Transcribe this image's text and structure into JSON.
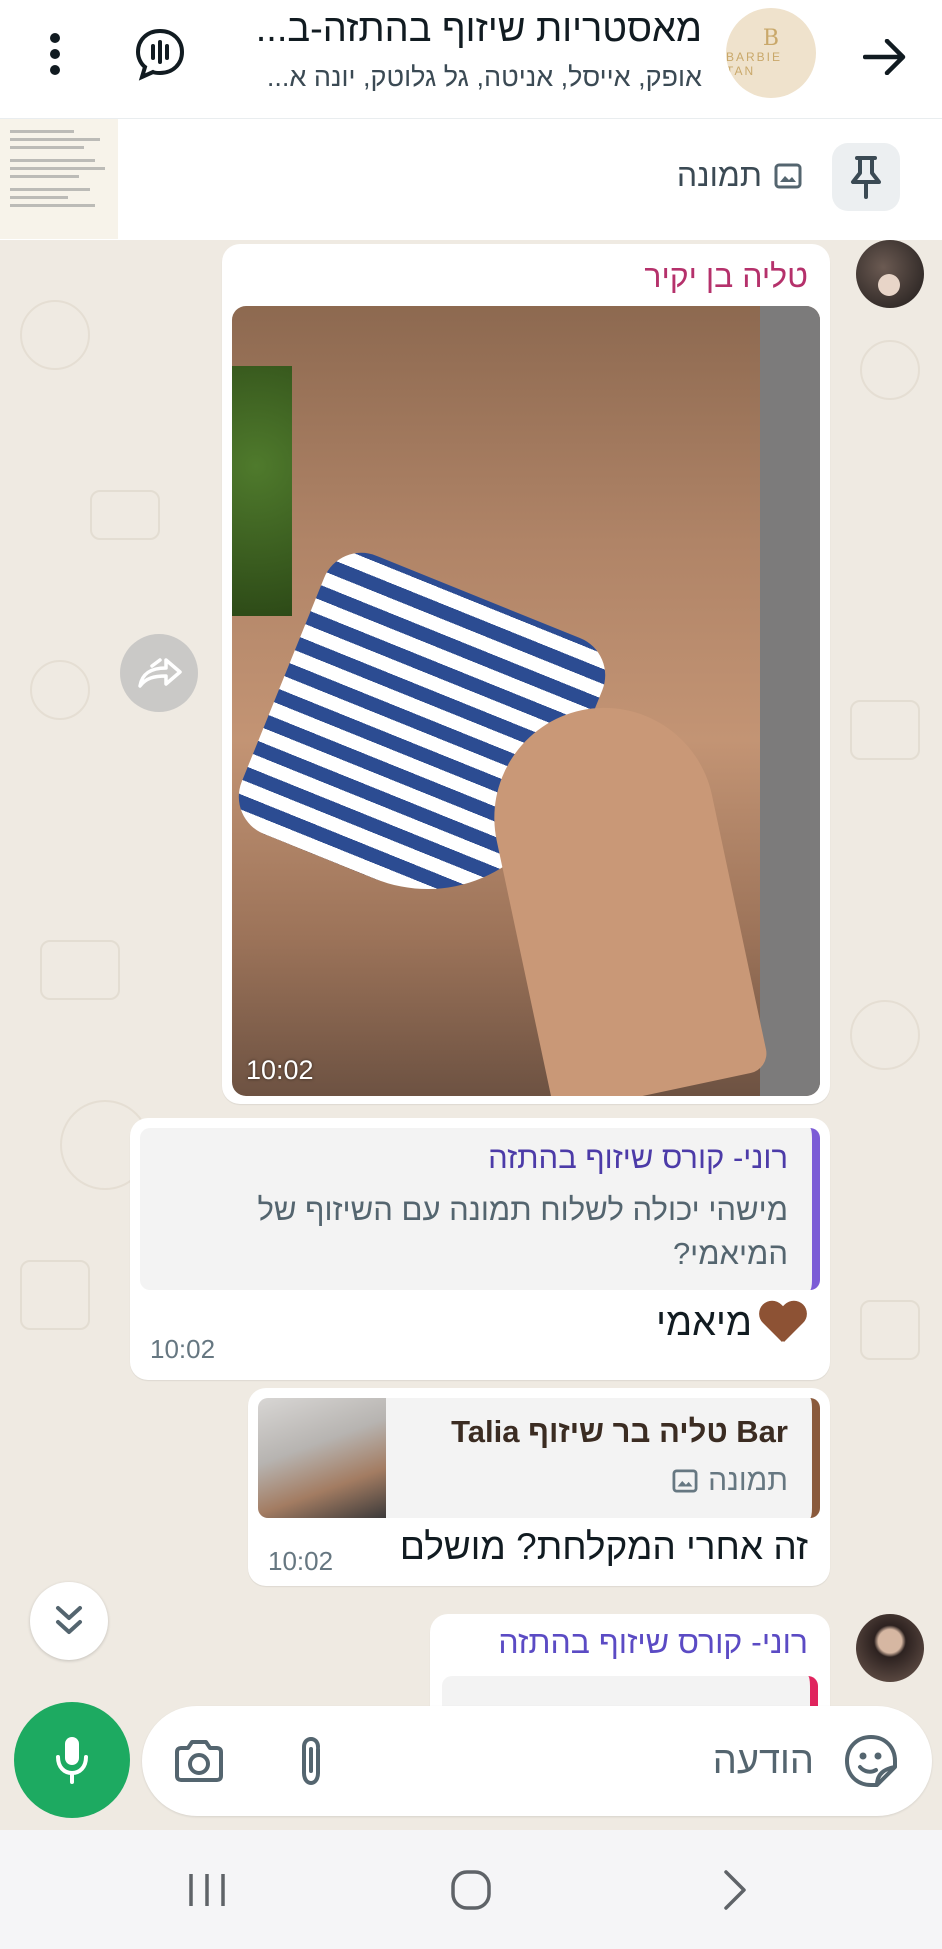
{
  "header": {
    "title": "מאסטריות שיזוף בהתזה-ב...",
    "subtitle": "אופק, אייסל, אניטה, גל גלוטק, יונה א...",
    "avatar_text_letter": "B",
    "avatar_text": "BARBIE TAN",
    "icons": [
      "arrow-right-icon",
      "voice-chat-icon",
      "more-vertical-icon"
    ]
  },
  "pinned": {
    "label": "תמונה",
    "icons": [
      "pin-icon",
      "image-icon"
    ]
  },
  "messages": [
    {
      "sender": "טליה בן יקיר",
      "type": "photo",
      "time": "10:02"
    },
    {
      "quoted_sender": "רוני- קורס שיזוף בהתזה",
      "quoted_text": "מישהי יכולה לשלוח תמונה עם השיזוף של המיאמי?",
      "text": "מיאמי",
      "emoji": "brown-heart",
      "time": "10:02"
    },
    {
      "quoted_sender": "Bar טליה בר שיזוף Talia",
      "quoted_text": "תמונה",
      "text": "זה אחרי המקלחת? מושלם",
      "time": "10:02"
    },
    {
      "sender": "רוני- קורס שיזוף בהתזה"
    }
  ],
  "composer": {
    "placeholder": "הודעה",
    "icons": [
      "sticker-icon",
      "paperclip-icon",
      "camera-icon",
      "mic-icon"
    ]
  },
  "colors": {
    "chat_bg": "#efeae2",
    "mic_green": "#1daa61",
    "sender_1": "#b5316b",
    "sender_2": "#5b4bc4",
    "quote_bar_1": "#7c5cd6",
    "quote_bar_2": "#8a5a3c"
  }
}
